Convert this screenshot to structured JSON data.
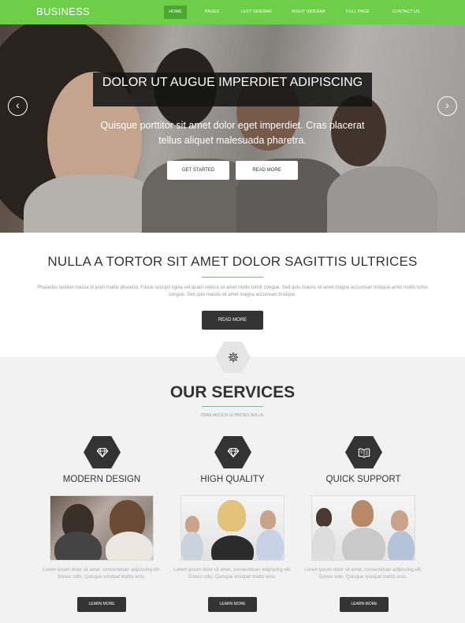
{
  "header": {
    "logo": "BUSINESS",
    "nav": [
      "HOME",
      "PAGES",
      "LEFT SIDEBAR",
      "RIGHT SIDEBAR",
      "FULL PAGE",
      "CONTACT US"
    ],
    "active_index": 0
  },
  "hero": {
    "title": "DOLOR UT AUGUE IMPERDIET ADIPISCING",
    "subtitle": "Quisque porttitor sit amet dolor eget imperdiet. Cras placerat tellus aliquet malesuada pharetra.",
    "buttons": [
      "GET STARTED",
      "READ MORE"
    ],
    "prev_icon": "‹",
    "next_icon": "›"
  },
  "intro": {
    "title": "NULLA A TORTOR SIT AMET DOLOR SAGITTIS ULTRICES",
    "text": "Phasellus laoreet massa id justo mattis pharetra. Fusce suscipit ligula vel quam viverra sit amet mollis tortor congue. Sed quis mauris sit amet magna accumsan tristique amet mollis tortor congue. Sed quis mauris sit amet magna accumsan tristique.",
    "button": "READ MORE"
  },
  "services": {
    "title": "OUR SERVICES",
    "subtitle": "CRAS IACULIS ULTRICIES NULLA.",
    "items": [
      {
        "title": "MODERN DESIGN",
        "icon": "diamond-icon",
        "text": "Lorem ipsum dolor sit amet, consectetuer adipiscing elit. Donec odio. Quisque volutpat mattis eros.",
        "button": "LEARN MORE"
      },
      {
        "title": "HIGH QUALITY",
        "icon": "diamond-icon",
        "text": "Lorem ipsum dolor sit amet, consectetuer adipiscing elit. Donec odio. Quisque volutpat mattis eros.",
        "button": "LEARN MORE"
      },
      {
        "title": "QUICK SUPPORT",
        "icon": "book-icon",
        "text": "Lorem ipsum dolor sit amet, consectetuer adipiscing elit. Donec odio. Quisque volutpat mattis eros.",
        "button": "LEARN MORE"
      }
    ]
  },
  "colors": {
    "accent": "#6ccf47",
    "accent_dark": "#4ea632",
    "dark": "#333333",
    "services_bg": "#f2f2f2"
  }
}
